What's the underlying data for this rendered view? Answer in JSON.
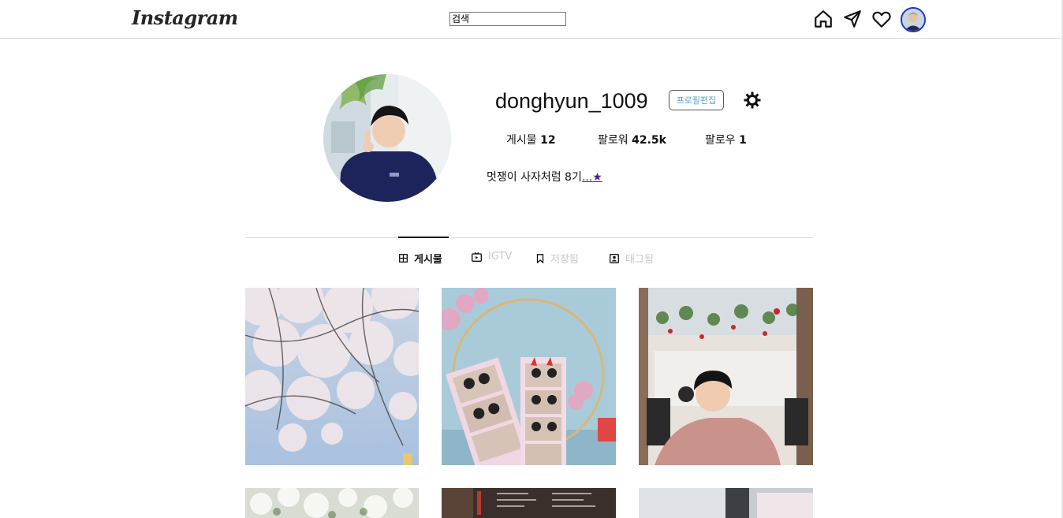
{
  "header": {
    "logo_text": "Instagram",
    "search_value": "검색",
    "icons": [
      "home-icon",
      "send-icon",
      "heart-icon",
      "avatar"
    ]
  },
  "profile": {
    "username": "donghyun_1009",
    "edit_label": "프로필편집",
    "stats": {
      "posts_label": "게시물",
      "posts_count": "12",
      "followers_label": "팔로워",
      "followers_count": "42.5k",
      "following_label": "팔로우",
      "following_count": "1"
    },
    "bio_text": "멋쟁이 사자처럼 8기",
    "bio_link": "...★"
  },
  "tabs": [
    {
      "label": "게시물",
      "icon": "grid-icon",
      "active": true
    },
    {
      "label": "IGTV",
      "icon": "igtv-icon",
      "active": false
    },
    {
      "label": "저장됨",
      "icon": "bookmark-icon",
      "active": false
    },
    {
      "label": "태그됨",
      "icon": "tag-icon",
      "active": false
    }
  ],
  "colors": {
    "accent_blue": "#1c36d6",
    "edit_text": "#5aa6c9",
    "border": "#dbdbdb"
  }
}
